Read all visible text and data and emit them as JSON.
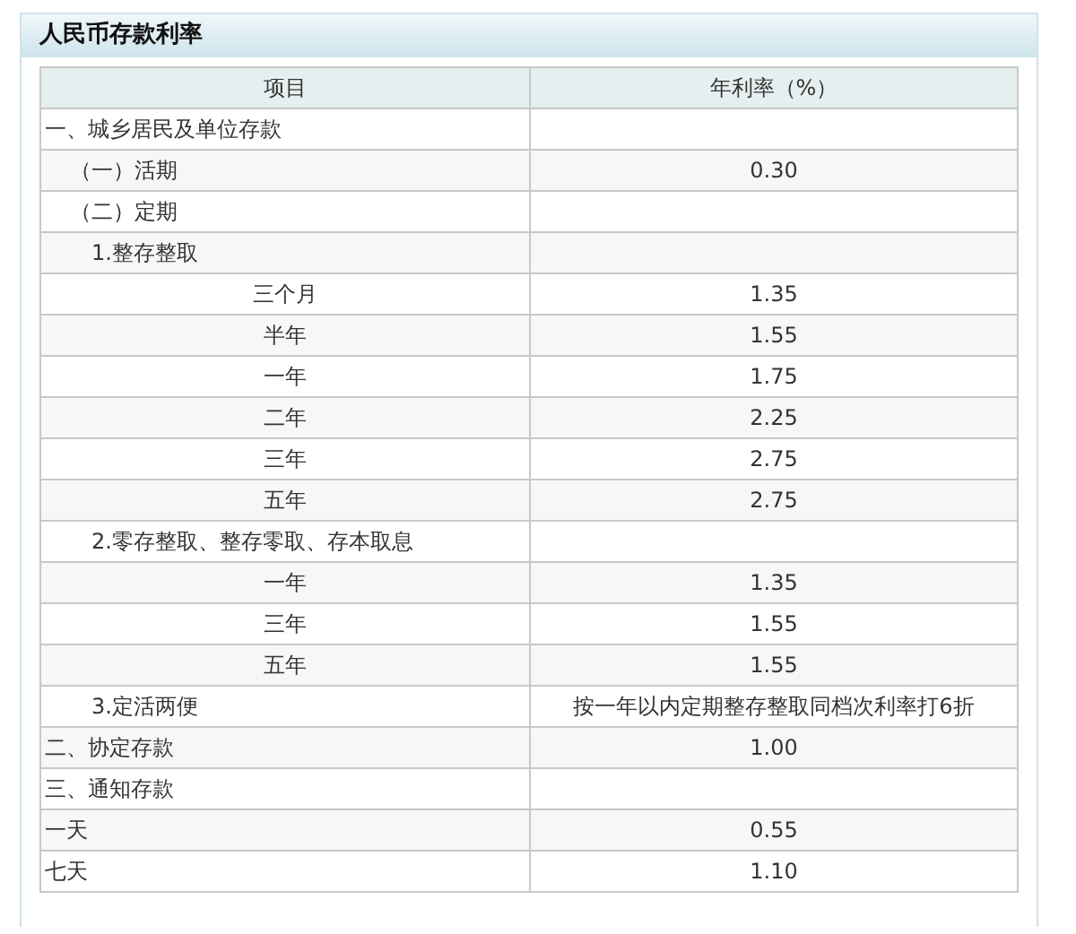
{
  "panel": {
    "title": "人民币存款利率"
  },
  "table": {
    "columns": [
      "项目",
      "年利率（%）"
    ],
    "rows": [
      {
        "kind": "section",
        "item": "一、城乡居民及单位存款",
        "rate": ""
      },
      {
        "kind": "sub",
        "item": "（一）活期",
        "rate": "0.30"
      },
      {
        "kind": "sub",
        "item": "（二）定期",
        "rate": ""
      },
      {
        "kind": "item",
        "item": "1.整存整取",
        "rate": ""
      },
      {
        "kind": "term",
        "item": "三个月",
        "rate": "1.35"
      },
      {
        "kind": "term",
        "item": "半年",
        "rate": "1.55"
      },
      {
        "kind": "term",
        "item": "一年",
        "rate": "1.75"
      },
      {
        "kind": "term",
        "item": "二年",
        "rate": "2.25"
      },
      {
        "kind": "term",
        "item": "三年",
        "rate": "2.75"
      },
      {
        "kind": "term",
        "item": "五年",
        "rate": "2.75"
      },
      {
        "kind": "item",
        "item": "2.零存整取、整存零取、存本取息",
        "rate": ""
      },
      {
        "kind": "term",
        "item": "一年",
        "rate": "1.35"
      },
      {
        "kind": "term",
        "item": "三年",
        "rate": "1.55"
      },
      {
        "kind": "term",
        "item": "五年",
        "rate": "1.55"
      },
      {
        "kind": "item",
        "item": "3.定活两便",
        "rate": "按一年以内定期整存整取同档次利率打6折"
      },
      {
        "kind": "section",
        "item": "二、协定存款",
        "rate": "1.00"
      },
      {
        "kind": "section",
        "item": "三、通知存款",
        "rate": ""
      },
      {
        "kind": "section",
        "item": "一天",
        "rate": "0.55"
      },
      {
        "kind": "section",
        "item": "七天",
        "rate": "1.10"
      }
    ]
  }
}
